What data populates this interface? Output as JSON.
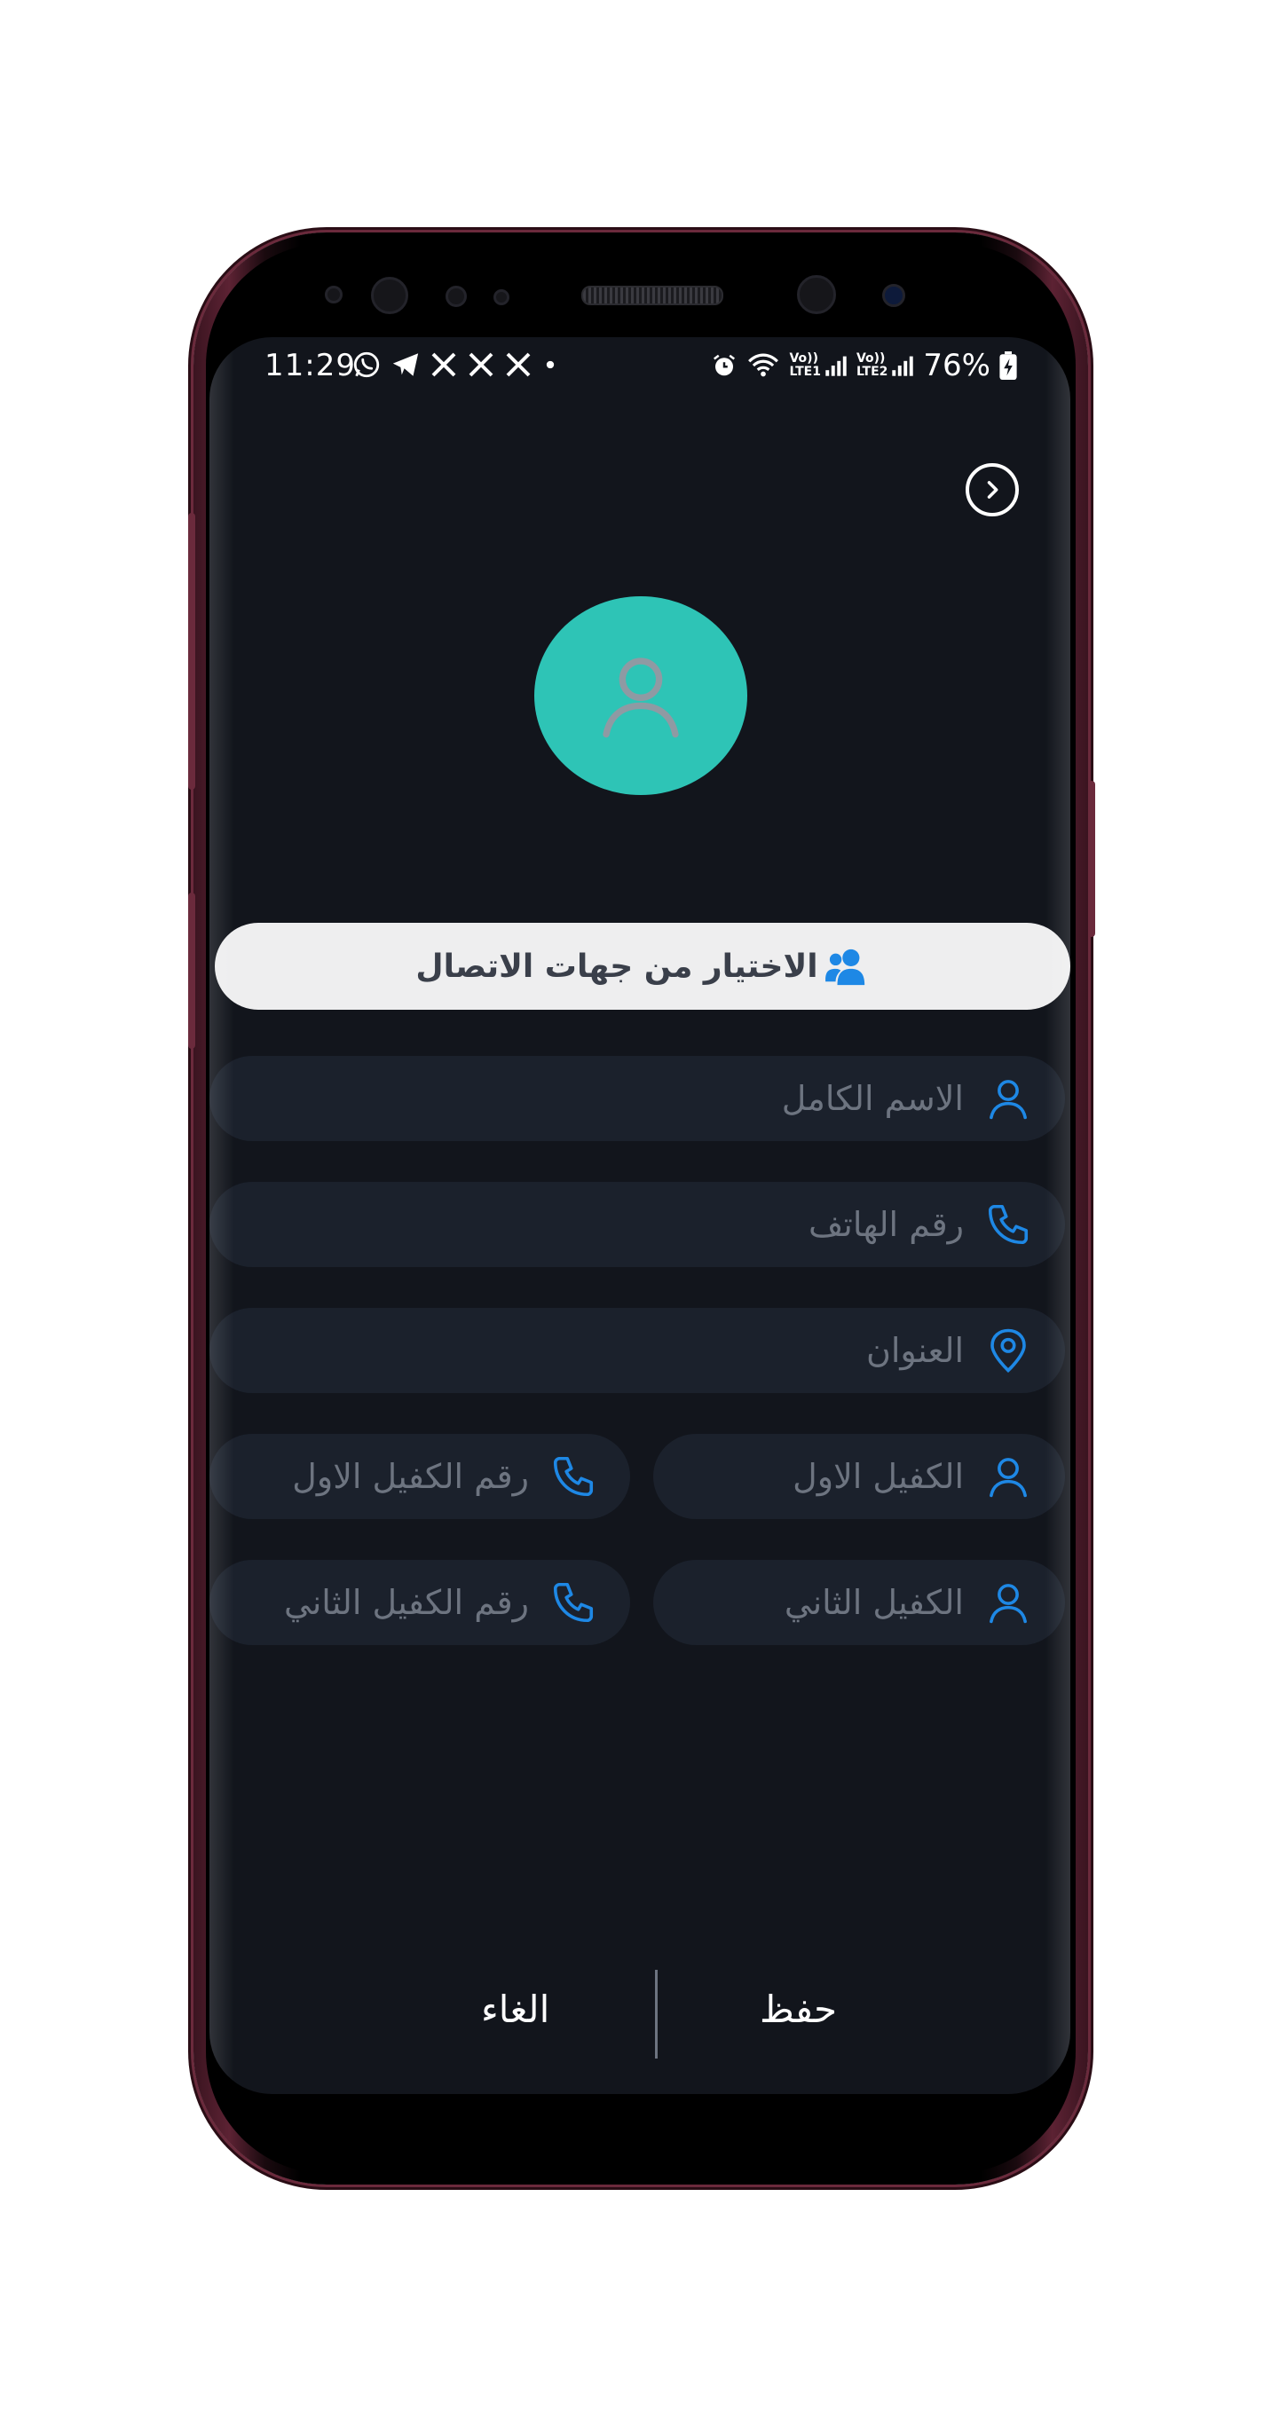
{
  "status_bar": {
    "time": "11:29",
    "left_icons": [
      "whatsapp-icon",
      "telegram-icon",
      "x-icon",
      "x-icon",
      "x-icon",
      "dot-icon"
    ],
    "right_icons": [
      "alarm-icon",
      "wifi-icon",
      "volte-lte1-signal-icon",
      "volte-lte2-signal-icon",
      "battery-charging-icon"
    ],
    "lte1": "LTE1",
    "lte2": "LTE2",
    "vo": "Vo))",
    "battery": "76%"
  },
  "header": {
    "forward_icon": "chevron-right-icon"
  },
  "avatar": {
    "icon": "user-icon",
    "color": "#2ec4b6"
  },
  "contacts_button": {
    "label": "الاختيار من جهات الاتصال",
    "icon": "users-icon"
  },
  "fields": {
    "full_name": {
      "placeholder": "الاسم الكامل",
      "icon": "user-icon"
    },
    "phone": {
      "placeholder": "رقم الهاتف",
      "icon": "phone-icon"
    },
    "address": {
      "placeholder": "العنوان",
      "icon": "location-pin-icon"
    },
    "guarantor1": {
      "placeholder": "الكفيل الاول",
      "icon": "user-icon"
    },
    "guarantor1_phone": {
      "placeholder": "رقم الكفيل الاول",
      "icon": "phone-icon"
    },
    "guarantor2": {
      "placeholder": "الكفيل الثاني",
      "icon": "user-icon"
    },
    "guarantor2_phone": {
      "placeholder": "رقم الكفيل الثاني",
      "icon": "phone-icon"
    }
  },
  "actions": {
    "save": "حفظ",
    "cancel": "الغاء"
  },
  "colors": {
    "background": "#12151c",
    "field_bg": "#1b212c",
    "accent": "#1e88e5",
    "placeholder": "#6d7480"
  }
}
